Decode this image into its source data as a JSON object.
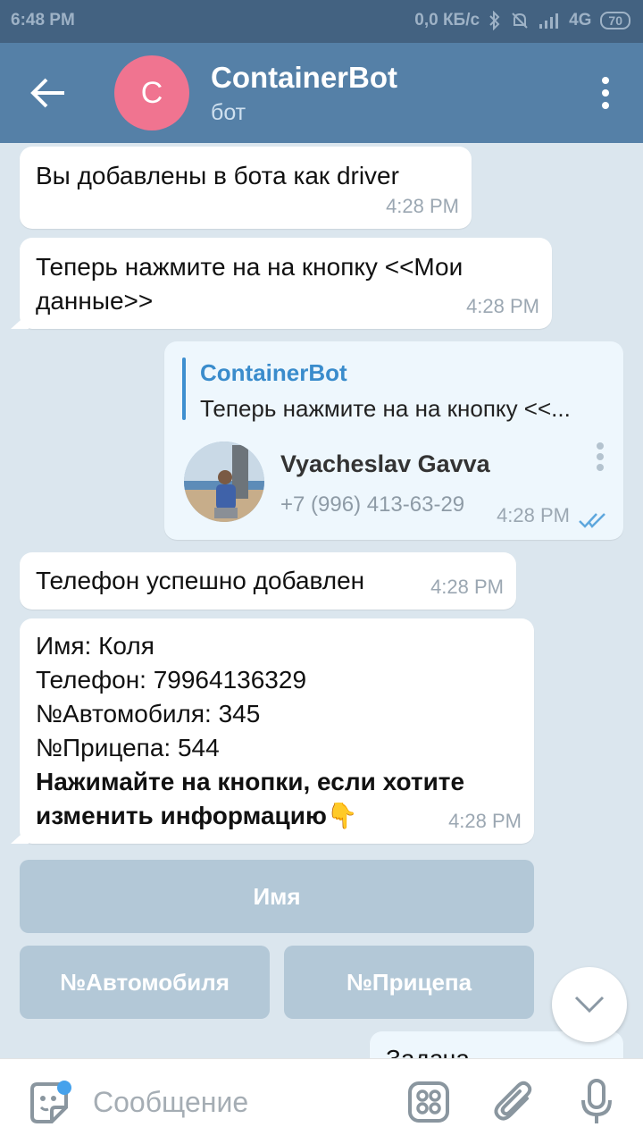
{
  "status_bar": {
    "time": "6:48 PM",
    "network_speed": "0,0 КБ/с",
    "network_type": "4G",
    "battery": "70"
  },
  "header": {
    "avatar_letter": "C",
    "title": "ContainerBot",
    "subtitle": "бот"
  },
  "messages": [
    {
      "text": "Вы добавлены в бота как driver",
      "time": "4:28 PM"
    },
    {
      "text_line1": "Теперь нажмите на на кнопку <<Мои",
      "text_line2": "данные>>",
      "time": "4:28 PM"
    },
    {
      "reply_name": "ContainerBot",
      "reply_text": "Теперь нажмите на на кнопку <<...",
      "contact_name": "Vyacheslav Gavva",
      "contact_phone": "+7 (996) 413-63-29",
      "time": "4:28 PM"
    },
    {
      "text": "Телефон успешно добавлен",
      "time": "4:28 PM"
    },
    {
      "line1": "Имя: Коля",
      "line2": "Телефон: 79964136329",
      "line3": "№Автомобиля: 345",
      "line4": "№Прицепа: 544",
      "bold_line1": "Нажимайте на кнопки, если хотите",
      "bold_line2": "изменить информацию",
      "emoji": "👇",
      "time": "4:28 PM"
    }
  ],
  "keyboard": {
    "btn_name": "Имя",
    "btn_car": "№Автомобиля",
    "btn_trailer": "№Прицепа"
  },
  "partial_message": "Задача",
  "input": {
    "placeholder": "Сообщение"
  },
  "colors": {
    "header": "#5580a7",
    "status_bar": "#436281",
    "background": "#dbe6ee",
    "accent": "#3a8ccc",
    "keyboard_button": "#b3c8d7"
  },
  "icons": [
    "back-arrow-icon",
    "more-vert-icon",
    "double-check-icon",
    "chevron-down-icon",
    "sticker-icon",
    "bot-commands-icon",
    "attach-icon",
    "microphone-icon"
  ]
}
